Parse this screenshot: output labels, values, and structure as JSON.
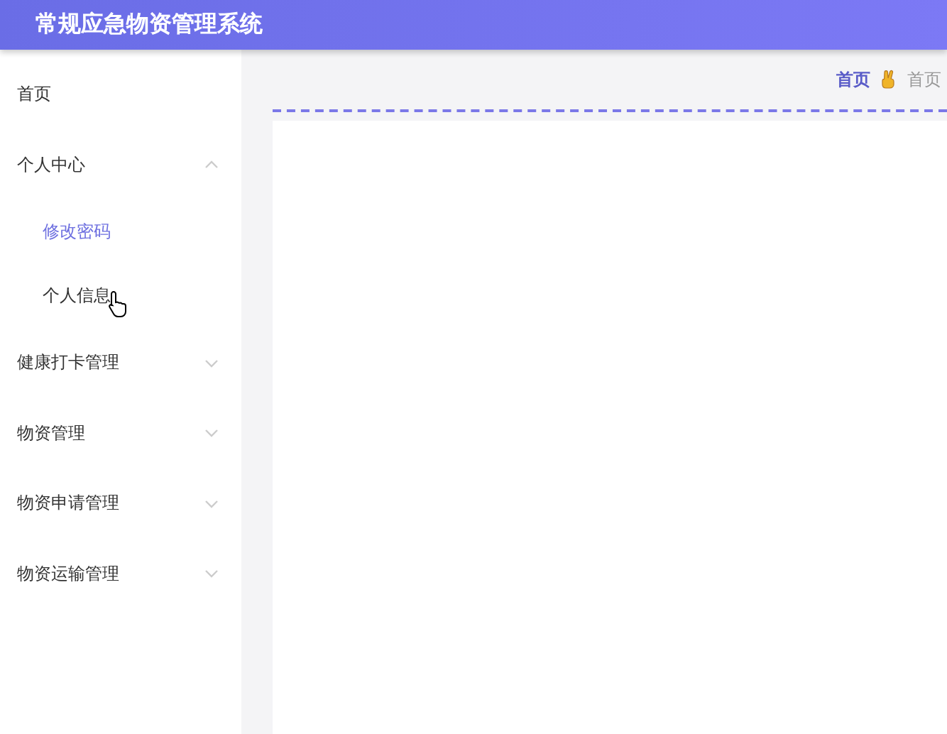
{
  "header": {
    "title": "常规应急物资管理系统"
  },
  "menu": [
    {
      "label": "首页",
      "selected": false
    },
    {
      "label": "个人中心",
      "expanded": true,
      "children": [
        {
          "label": "修改密码",
          "selected": true
        },
        {
          "label": "个人信息",
          "selected": false
        }
      ]
    },
    {
      "label": "健康打卡管理",
      "expanded": false
    },
    {
      "label": "物资管理",
      "expanded": false
    },
    {
      "label": "物资申请管理",
      "expanded": false
    },
    {
      "label": "物资运输管理",
      "expanded": false
    }
  ],
  "breadcrumb": [
    {
      "label": "首页",
      "selected": true
    },
    {
      "label": "首页",
      "selected": false
    }
  ]
}
